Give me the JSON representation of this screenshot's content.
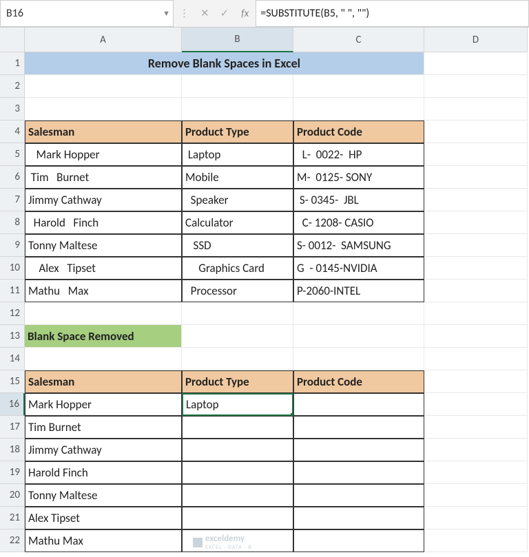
{
  "nameBox": "B16",
  "formula": "=SUBSTITUTE(B5, \" \", \"\")",
  "colHeaders": [
    "A",
    "B",
    "C",
    "D"
  ],
  "rowHeaders": [
    "1",
    "2",
    "3",
    "4",
    "5",
    "6",
    "7",
    "8",
    "9",
    "10",
    "11",
    "12",
    "13",
    "14",
    "15",
    "16",
    "17",
    "18",
    "19",
    "20",
    "21",
    "22"
  ],
  "title": "Remove Blank Spaces in Excel",
  "table1": {
    "headers": [
      "Salesman",
      "Product Type",
      "Product Code"
    ],
    "rows": [
      [
        "   Mark Hopper",
        " Laptop",
        "  L-  0022-  HP"
      ],
      [
        " Tim   Burnet",
        "Mobile",
        "M-  0125- SONY"
      ],
      [
        "Jimmy Cathway",
        "  Speaker",
        " S- 0345-  JBL"
      ],
      [
        "  Harold   Finch",
        "Calculator",
        "  C- 1208- CASIO"
      ],
      [
        "Tonny Maltese",
        "   SSD",
        "S- 0012-  SAMSUNG"
      ],
      [
        "    Alex   Tipset",
        "     Graphics Card",
        "G  - 0145-NVIDIA"
      ],
      [
        "Mathu   Max",
        "  Processor",
        "P-2060-INTEL"
      ]
    ]
  },
  "removedLabel": "Blank Space Removed",
  "table2": {
    "headers": [
      "Salesman",
      "Product Type",
      "Product Code"
    ],
    "rows": [
      [
        "Mark Hopper",
        "Laptop",
        ""
      ],
      [
        "Tim Burnet",
        "",
        ""
      ],
      [
        "Jimmy Cathway",
        "",
        ""
      ],
      [
        "Harold Finch",
        "",
        ""
      ],
      [
        "Tonny Maltese",
        "",
        ""
      ],
      [
        "Alex Tipset",
        "",
        ""
      ],
      [
        "Mathu Max",
        "",
        ""
      ]
    ]
  },
  "watermark": {
    "brand": "exceldemy",
    "sub": "EXCEL · DATA · B"
  }
}
